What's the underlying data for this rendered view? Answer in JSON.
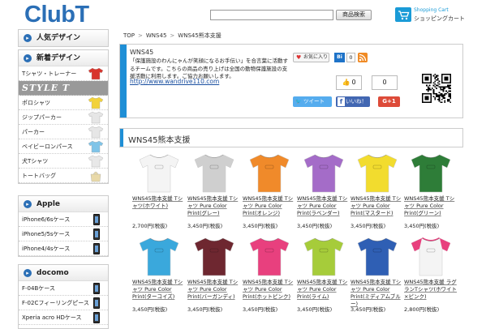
{
  "header": {
    "logo": "ClubT",
    "search_placeholder": "",
    "search_button": "商品検索",
    "cart_title": "Shopping Cart",
    "cart_label": "ショッピングカート"
  },
  "sidebar": {
    "popular": "人気デザイン",
    "newest": "新着デザイン",
    "categories": [
      {
        "label": "Tシャツ・トレーナー",
        "color": "#d8342c"
      },
      {
        "label": "STYLE T",
        "color": "#999999"
      },
      {
        "label": "ポロシャツ",
        "color": "#f2d23a"
      },
      {
        "label": "ジップパーカー",
        "color": "#e6e6e6"
      },
      {
        "label": "パーカー",
        "color": "#e6e6e6"
      },
      {
        "label": "ベイビーロンパース",
        "color": "#7fc4e8"
      },
      {
        "label": "犬Tシャツ",
        "color": "#e8e8e8"
      },
      {
        "label": "トートバッグ",
        "color": "#e9d9a8"
      }
    ],
    "apple_title": "Apple",
    "apple_items": [
      "iPhone6/6sケース",
      "iPhone5/5sケース",
      "iPhone4/4sケース"
    ],
    "docomo_title": "docomo",
    "docomo_items": [
      "F-04Bケース",
      "F-02Cフィーリングピース",
      "Xperia acro HDケース"
    ]
  },
  "breadcrumb": [
    "TOP",
    "WNS45",
    "WNS45熊本支援"
  ],
  "info": {
    "title": "WNS45",
    "desc": "「保護施設のわんにゃんが笑顔になるお手伝い」を合言葉に活動するチームです。こちらの商品の売り上げは全国の動物保護施設の支援活動に利用します。ご協力お願いします。",
    "link": "http://www.wandrive110.com",
    "fav_label": "お気に入り",
    "bi_label": "Bi",
    "bi_count": "0",
    "like_count": "0",
    "plus_count": "0",
    "tweet_label": "ツイート",
    "fb_label": "いいね！",
    "gplus_label": "G+1"
  },
  "section_title": "WNS45熊本支援",
  "products": [
    {
      "name": "WNS45熊本支援 Tシャツ(ホワイト)",
      "price": "2,700円(税抜)",
      "color": "#f4f4f4",
      "type": "tee"
    },
    {
      "name": "WNS45熊本支援 Tシャツ Pure Color Print(グレー)",
      "price": "3,450円(税抜)",
      "color": "#cfcfcf",
      "type": "tee"
    },
    {
      "name": "WNS45熊本支援 Tシャツ Pure Color Print(オレンジ)",
      "price": "3,450円(税抜)",
      "color": "#f08a2a",
      "type": "tee"
    },
    {
      "name": "WNS45熊本支援 Tシャツ Pure Color Print(ラベンダー)",
      "price": "3,450円(税抜)",
      "color": "#a46cc8",
      "type": "tee"
    },
    {
      "name": "WNS45熊本支援 Tシャツ Pure Color Print(マスタード)",
      "price": "3,450円(税抜)",
      "color": "#f2dc2e",
      "type": "tee"
    },
    {
      "name": "WNS45熊本支援 Tシャツ Pure Color Print(グリーン)",
      "price": "3,450円(税抜)",
      "color": "#2e7d38",
      "type": "tee"
    },
    {
      "name": "WNS45熊本支援 Tシャツ Pure Color Print(ターコイズ)",
      "price": "3,450円(税抜)",
      "color": "#3aa8dc",
      "type": "tee"
    },
    {
      "name": "WNS45熊本支援 Tシャツ Pure Color Print(バーガンディ)",
      "price": "3,450円(税抜)",
      "color": "#6e2730",
      "type": "tee"
    },
    {
      "name": "WNS45熊本支援 Tシャツ Pure Color Print(ホットピンク)",
      "price": "3,450円(税抜)",
      "color": "#e8407e",
      "type": "tee"
    },
    {
      "name": "WNS45熊本支援 Tシャツ Pure Color Print(ライム)",
      "price": "3,450円(税抜)",
      "color": "#a6cc3a",
      "type": "tee"
    },
    {
      "name": "WNS45熊本支援 Tシャツ Pure Color Print(ミディアムブルー)",
      "price": "3,450円(税抜)",
      "color": "#2f5fb4",
      "type": "tee"
    },
    {
      "name": "WNS45熊本支援 ラグランTシャツ(ホワイト×ピンク)",
      "price": "2,800円(税抜)",
      "color": "#f4f4f4",
      "sleeve": "#e8407e",
      "type": "raglan"
    }
  ]
}
